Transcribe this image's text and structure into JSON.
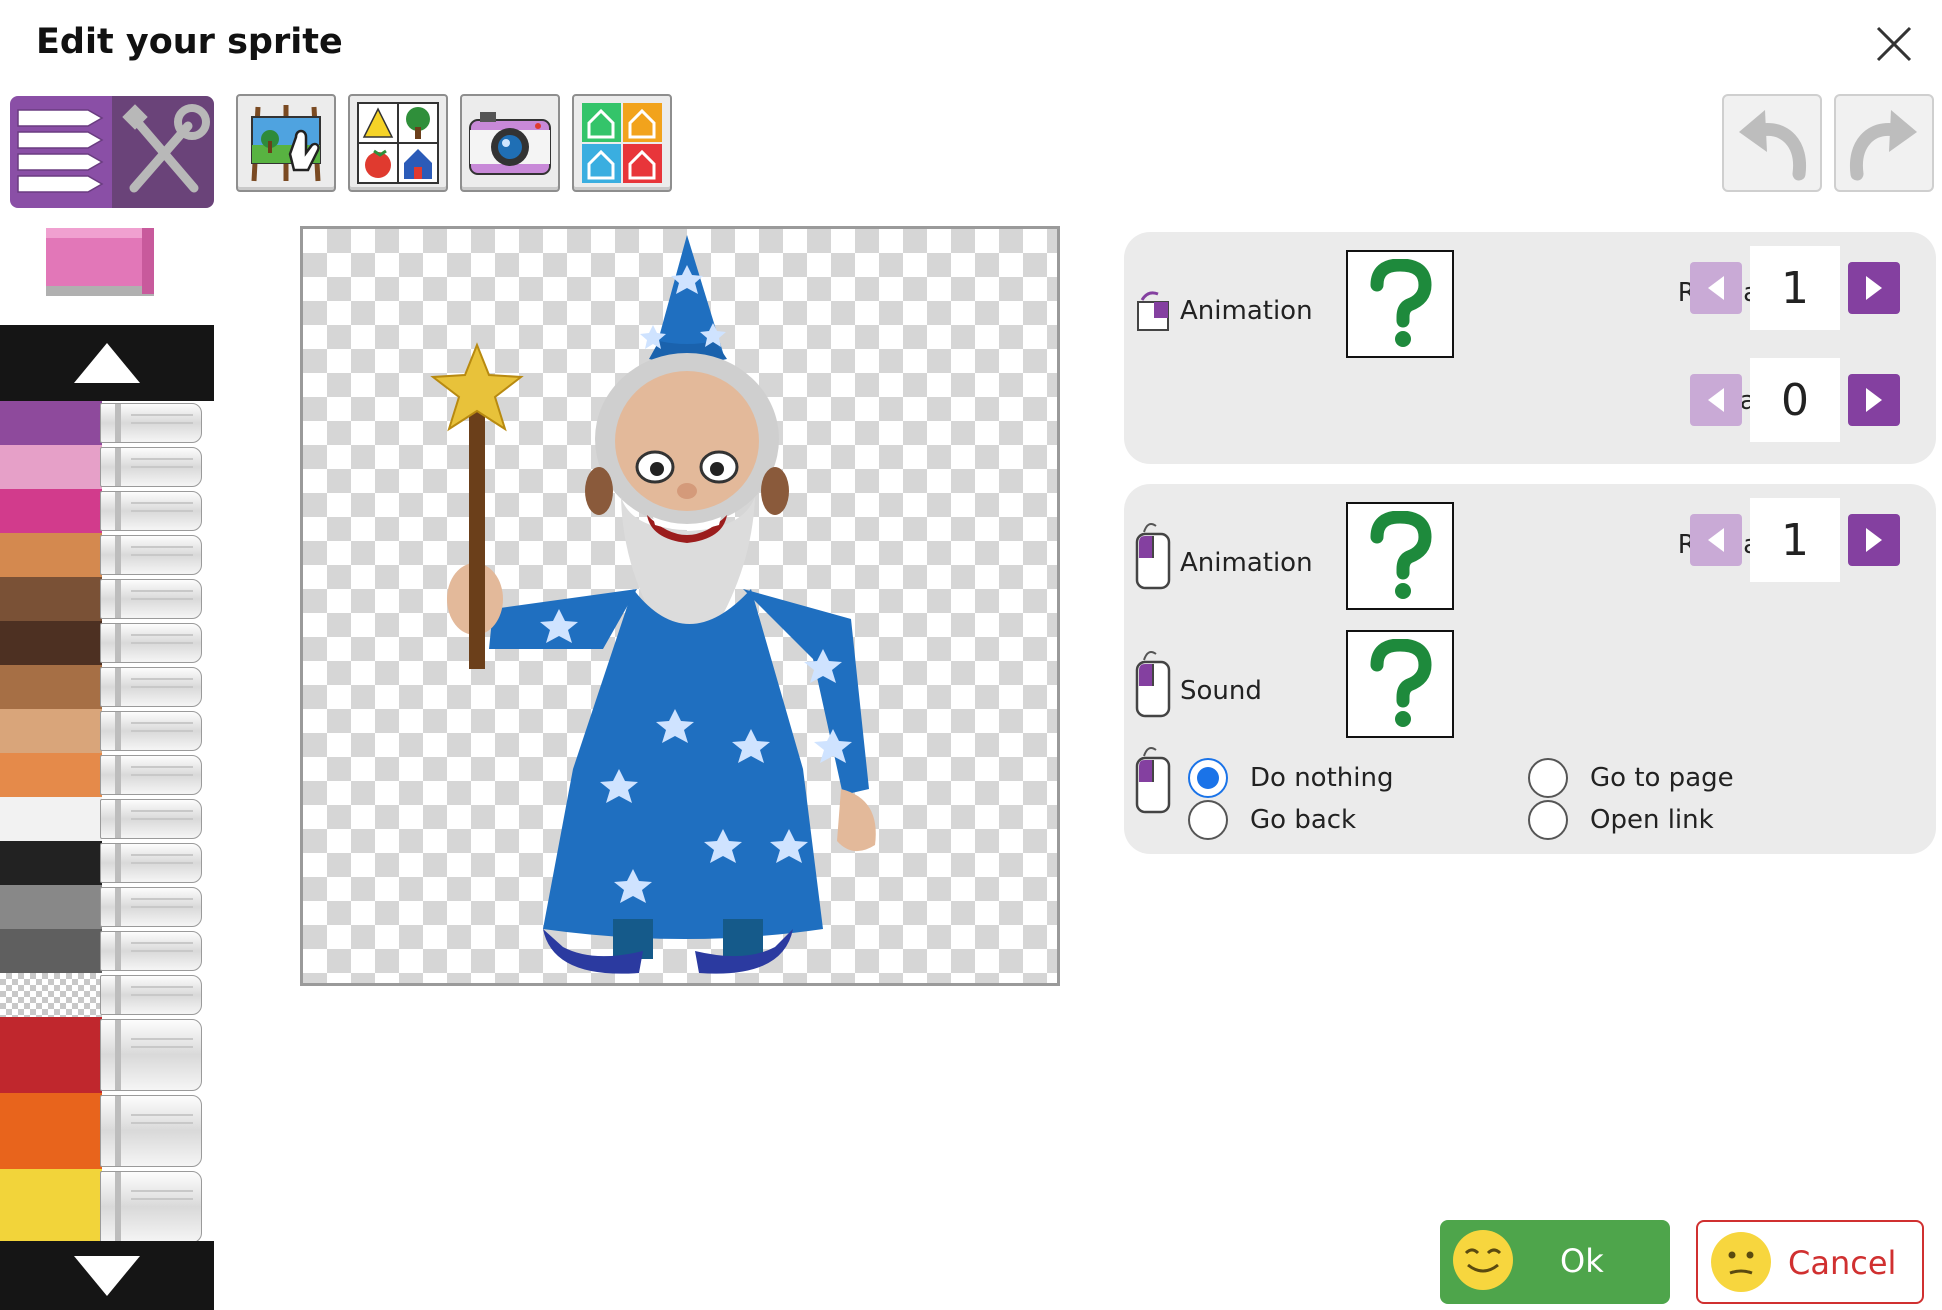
{
  "dialog": {
    "title": "Edit your sprite"
  },
  "toolbar": {
    "tools": [
      {
        "name": "background-picker",
        "icon": "easel-hand-icon"
      },
      {
        "name": "clipart-picker",
        "icon": "shapes-icon"
      },
      {
        "name": "camera",
        "icon": "camera-icon"
      },
      {
        "name": "templates",
        "icon": "houses-icon"
      }
    ],
    "undo_icon": "undo-icon",
    "redo_icon": "redo-icon"
  },
  "palette": {
    "marker_colors": [
      "#8e4a9c",
      "#e6a0c8",
      "#d23b8c",
      "#d4894f",
      "#7a5136",
      "#4d3022",
      "#a66f45",
      "#d9a57a",
      "#e58a4a",
      "#f2f2f2",
      "#222222",
      "#888888",
      "#5f5f5f",
      "transparent",
      "#c0272d",
      "#e8641c",
      "#f2d43a"
    ]
  },
  "timer_panel": {
    "animation_label": "Animation",
    "repeat_label": "Repeat:",
    "repeat_value": "1",
    "delay_label": "Delay:",
    "delay_value": "0"
  },
  "click_panel": {
    "animation_label": "Animation",
    "repeat_label": "Repeat:",
    "repeat_value": "1",
    "sound_label": "Sound",
    "actions": {
      "do_nothing": "Do nothing",
      "go_back": "Go back",
      "go_to_page": "Go to page",
      "open_link": "Open link",
      "selected": "do_nothing"
    }
  },
  "buttons": {
    "ok": "Ok",
    "cancel": "Cancel"
  },
  "colors": {
    "accent_purple": "#8440a0",
    "ok_green": "#4ea54b",
    "cancel_red": "#d03030",
    "question_green": "#1e8a3c"
  }
}
